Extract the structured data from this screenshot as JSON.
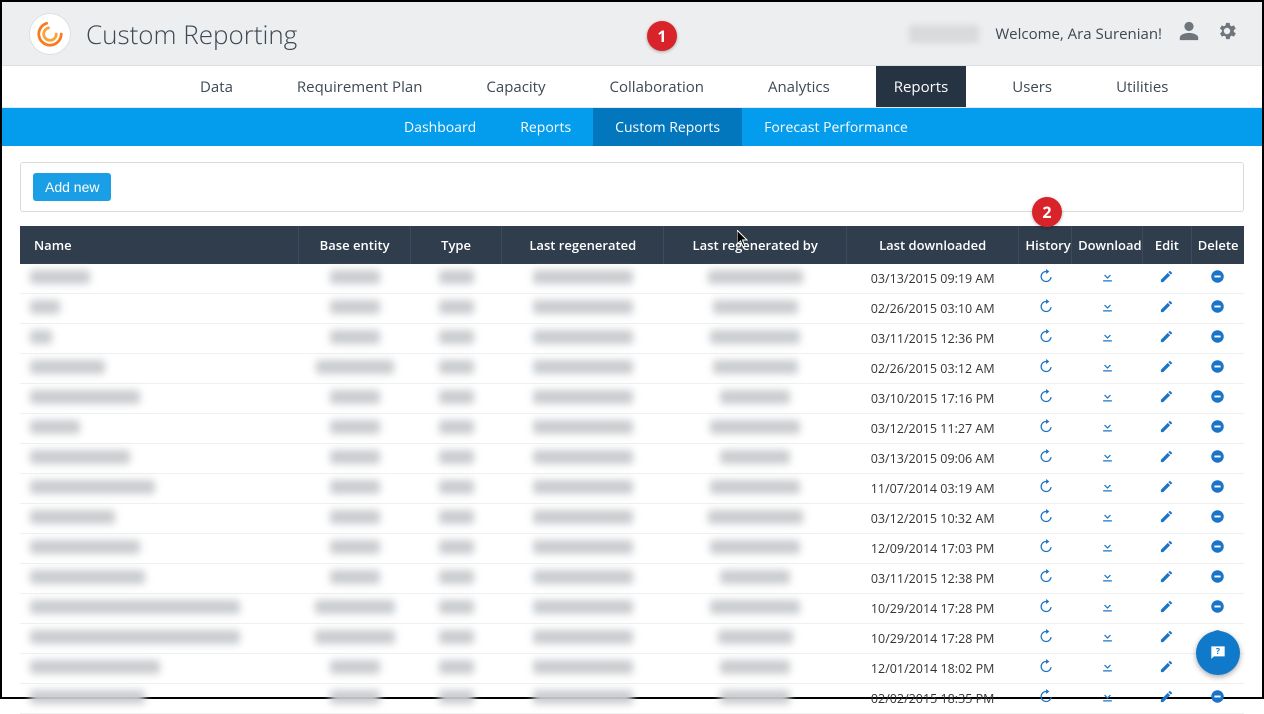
{
  "header": {
    "app_title": "Custom Reporting",
    "welcome": "Welcome, Ara Surenian!"
  },
  "primary_nav": {
    "items": [
      {
        "label": "Data",
        "active": false
      },
      {
        "label": "Requirement Plan",
        "active": false
      },
      {
        "label": "Capacity",
        "active": false
      },
      {
        "label": "Collaboration",
        "active": false
      },
      {
        "label": "Analytics",
        "active": false
      },
      {
        "label": "Reports",
        "active": true
      },
      {
        "label": "Users",
        "active": false
      },
      {
        "label": "Utilities",
        "active": false
      }
    ]
  },
  "secondary_nav": {
    "items": [
      {
        "label": "Dashboard",
        "active": false
      },
      {
        "label": "Reports",
        "active": false
      },
      {
        "label": "Custom Reports",
        "active": true
      },
      {
        "label": "Forecast Performance",
        "active": false
      }
    ]
  },
  "toolbar": {
    "add_new_label": "Add new"
  },
  "table": {
    "columns": {
      "name": "Name",
      "base_entity": "Base entity",
      "type": "Type",
      "last_regenerated": "Last regenerated",
      "last_regenerated_by": "Last regenerated by",
      "last_downloaded": "Last downloaded",
      "history": "History",
      "download": "Download",
      "edit": "Edit",
      "delete": "Delete"
    },
    "rows": [
      {
        "last_downloaded": "03/13/2015 09:19 AM",
        "name_w": 60,
        "entity_w": 50,
        "type_w": 35,
        "regen_w": 100,
        "by_w": 95
      },
      {
        "last_downloaded": "02/26/2015 03:10 AM",
        "name_w": 30,
        "entity_w": 50,
        "type_w": 35,
        "regen_w": 100,
        "by_w": 85
      },
      {
        "last_downloaded": "03/11/2015 12:36 PM",
        "name_w": 22,
        "entity_w": 50,
        "type_w": 35,
        "regen_w": 100,
        "by_w": 90
      },
      {
        "last_downloaded": "02/26/2015 03:12 AM",
        "name_w": 75,
        "entity_w": 78,
        "type_w": 35,
        "regen_w": 100,
        "by_w": 85
      },
      {
        "last_downloaded": "03/10/2015 17:16 PM",
        "name_w": 110,
        "entity_w": 50,
        "type_w": 35,
        "regen_w": 100,
        "by_w": 70
      },
      {
        "last_downloaded": "03/12/2015 11:27 AM",
        "name_w": 50,
        "entity_w": 50,
        "type_w": 35,
        "regen_w": 100,
        "by_w": 90
      },
      {
        "last_downloaded": "03/13/2015 09:06 AM",
        "name_w": 100,
        "entity_w": 50,
        "type_w": 35,
        "regen_w": 100,
        "by_w": 70
      },
      {
        "last_downloaded": "11/07/2014 03:19 AM",
        "name_w": 125,
        "entity_w": 50,
        "type_w": 35,
        "regen_w": 100,
        "by_w": 90
      },
      {
        "last_downloaded": "03/12/2015 10:32 AM",
        "name_w": 85,
        "entity_w": 50,
        "type_w": 35,
        "regen_w": 100,
        "by_w": 95
      },
      {
        "last_downloaded": "12/09/2014 17:03 PM",
        "name_w": 110,
        "entity_w": 50,
        "type_w": 35,
        "regen_w": 100,
        "by_w": 90
      },
      {
        "last_downloaded": "03/11/2015 12:38 PM",
        "name_w": 115,
        "entity_w": 50,
        "type_w": 35,
        "regen_w": 100,
        "by_w": 70
      },
      {
        "last_downloaded": "10/29/2014 17:28 PM",
        "name_w": 210,
        "entity_w": 80,
        "type_w": 35,
        "regen_w": 100,
        "by_w": 90
      },
      {
        "last_downloaded": "10/29/2014 17:28 PM",
        "name_w": 210,
        "entity_w": 80,
        "type_w": 35,
        "regen_w": 100,
        "by_w": 75
      },
      {
        "last_downloaded": "12/01/2014 18:02 PM",
        "name_w": 130,
        "entity_w": 50,
        "type_w": 35,
        "regen_w": 100,
        "by_w": 70
      },
      {
        "last_downloaded": "02/02/2015 18:35 PM",
        "name_w": 115,
        "entity_w": 50,
        "type_w": 35,
        "regen_w": 100,
        "by_w": 70
      }
    ]
  },
  "callouts": {
    "one": "1",
    "two": "2"
  }
}
